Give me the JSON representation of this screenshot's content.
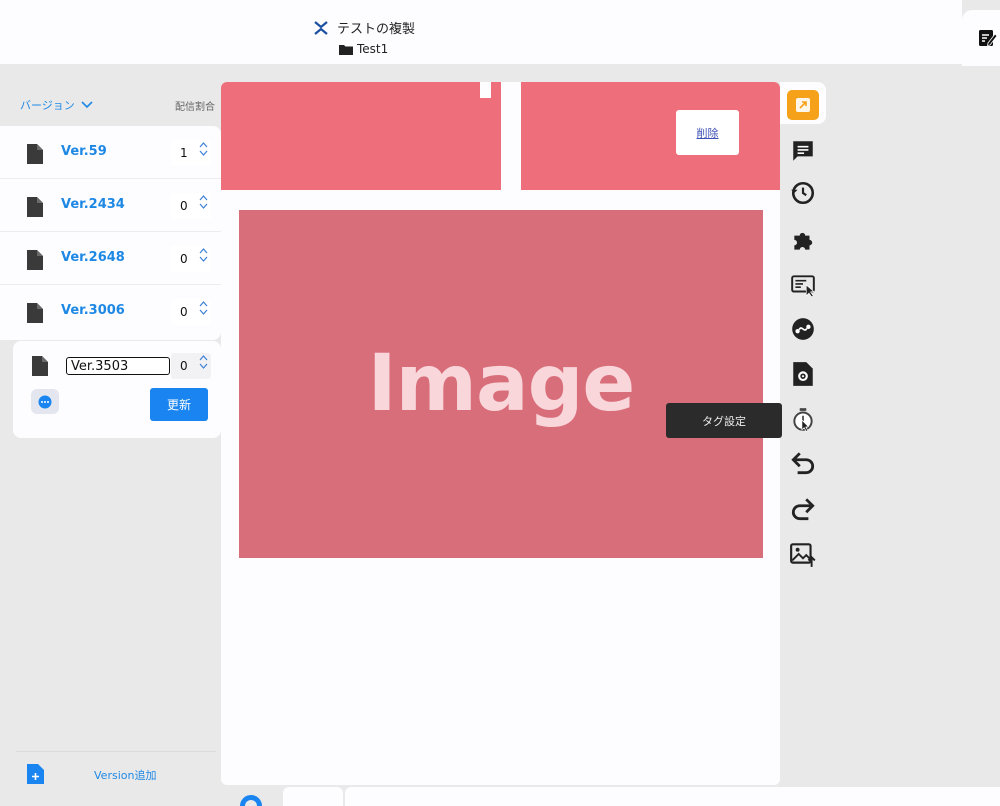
{
  "header": {
    "title": "テストの複製",
    "folder": "Test1"
  },
  "sidebar": {
    "versions_label": "バージョン",
    "ratio_label": "配信割合",
    "versions": [
      {
        "name": "Ver.59",
        "ratio": "1"
      },
      {
        "name": "Ver.2434",
        "ratio": "0"
      },
      {
        "name": "Ver.2648",
        "ratio": "0"
      },
      {
        "name": "Ver.3006",
        "ratio": "0"
      }
    ],
    "editing": {
      "name": "Ver.3503",
      "ratio": "0",
      "update_label": "更新"
    },
    "add_version_label": "Version追加"
  },
  "canvas": {
    "delete_label": "削除",
    "image_placeholder": "Image"
  },
  "toolbar": {
    "tooltip": "タグ設定",
    "items": [
      "open-icon",
      "comment-icon",
      "history-icon",
      "puzzle-icon",
      "select-icon",
      "link-icon",
      "file-settings-icon",
      "tag-timer-icon",
      "undo-icon",
      "redo-icon",
      "image-upload-icon"
    ]
  },
  "colors": {
    "accent": "#1a85f0",
    "banner": "#ef6e7c",
    "image": "#d96e7b",
    "active_tool": "#f5a21a"
  }
}
